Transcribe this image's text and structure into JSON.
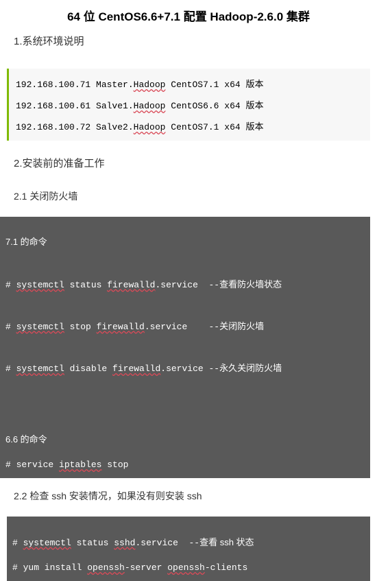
{
  "title": "64 位 CentOS6.6+7.1 配置 Hadoop-2.6.0 集群",
  "h1": "1.系统环境说明",
  "hosts": [
    {
      "ip": "192.168.100.71",
      "name_pre": "Master.",
      "name_sq": "Hadoop",
      "os_pre": "CentOS7.1 x64 ",
      "os_ch": "版本"
    },
    {
      "ip": "192.168.100.61",
      "name_pre": "Salve1.",
      "name_sq": "Hadoop",
      "os_pre": "CentOS6.6 x64 ",
      "os_ch": "版本"
    },
    {
      "ip": "192.168.100.72",
      "name_pre": "Salve2.",
      "name_sq": "Hadoop",
      "os_pre": "CentOS7.1 x64 ",
      "os_ch": "版本"
    }
  ],
  "h2": "2.安装前的准备工作",
  "h2_1": "2.1 关闭防火墙",
  "code1": {
    "l1": "7.1 的命令",
    "l2p": "# ",
    "l2a": "systemctl",
    "l2b": " status ",
    "l2c": "firewalld",
    "l2d": ".service  --",
    "l2e": "查看防火墙状态",
    "l3p": "# ",
    "l3a": "systemctl",
    "l3b": " stop ",
    "l3c": "firewalld",
    "l3d": ".service    --",
    "l3e": "关闭防火墙",
    "l4p": "# ",
    "l4a": "systemctl",
    "l4b": " disable ",
    "l4c": "firewalld",
    "l4d": ".service --",
    "l4e": "永久关闭防火墙",
    "l5": "6.6 的命令",
    "l6p": "# service ",
    "l6a": "iptables",
    "l6b": " stop"
  },
  "h2_2": "2.2 检查 ssh 安装情况，如果没有则安装 ssh",
  "code2": {
    "l1p": "# ",
    "l1a": "systemctl",
    "l1b": " status ",
    "l1c": "sshd",
    "l1d": ".service  --",
    "l1e": "查看 ssh 状态",
    "l2p": "# yum install ",
    "l2a": "openssh",
    "l2b": "-server ",
    "l2c": "openssh",
    "l2d": "-clients"
  }
}
